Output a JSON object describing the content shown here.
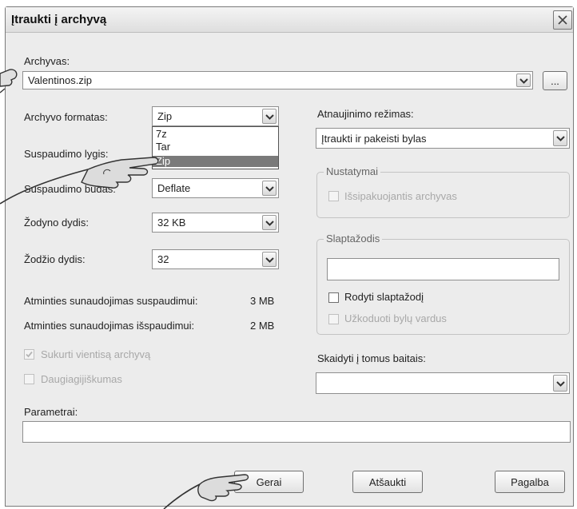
{
  "window": {
    "title": "Įtraukti į archyvą"
  },
  "archive": {
    "label": "Archyvas:",
    "value": "Valentinos.zip",
    "browse_label": "..."
  },
  "format": {
    "label": "Archyvo formatas:",
    "value": "Zip",
    "options": [
      "7z",
      "Tar",
      "Zip"
    ],
    "selected_option": "Zip"
  },
  "compression_level": {
    "label": "Suspaudimo lygis:"
  },
  "compression_method": {
    "label": "Suspaudimo būdas:",
    "value": "Deflate"
  },
  "dictionary_size": {
    "label": "Žodyno dydis:",
    "value": "32 KB"
  },
  "word_size": {
    "label": "Žodžio dydis:",
    "value": "32"
  },
  "memory": {
    "compress_label": "Atminties sunaudojimas suspaudimui:",
    "compress_value": "3 MB",
    "decompress_label": "Atminties sunaudojimas išspaudimui:",
    "decompress_value": "2 MB"
  },
  "solid_archive": {
    "label": "Sukurti vientisą archyvą",
    "checked": true,
    "disabled": true
  },
  "multithreading": {
    "label": "Daugiagijiškumas",
    "checked": false,
    "disabled": true
  },
  "parameters": {
    "label": "Parametrai:",
    "value": ""
  },
  "update_mode": {
    "label": "Atnaujinimo režimas:",
    "value": "Įtraukti ir pakeisti bylas"
  },
  "options_group": {
    "title": "Nustatymai",
    "sfx_label": "Išsipakuojantis archyvas"
  },
  "password_group": {
    "title": "Slaptažodis",
    "password_value": "",
    "show_password_label": "Rodyti slaptažodį",
    "encrypt_names_label": "Užkoduoti bylų vardus"
  },
  "split": {
    "label": "Skaidyti į tomus baitais:",
    "value": ""
  },
  "buttons": {
    "ok": "Gerai",
    "cancel": "Atšaukti",
    "help": "Pagalba"
  },
  "colors": {
    "dialog_bg": "#ececec",
    "selection": "#7a7a7a",
    "disabled_text": "#a8a8a8"
  }
}
